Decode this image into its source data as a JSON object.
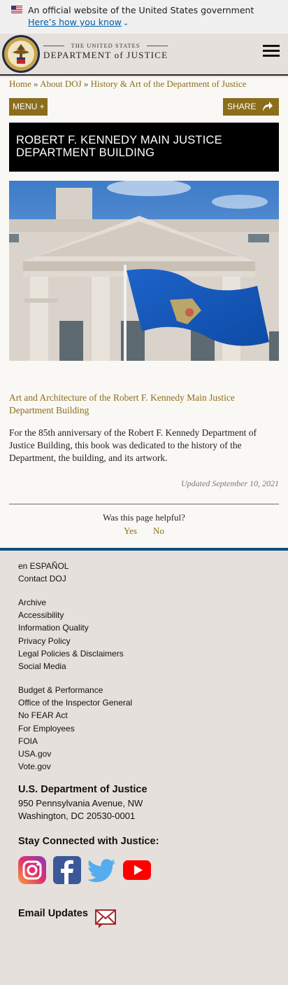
{
  "gov_banner": {
    "text": "An official website of the United States government",
    "link": "Here’s how you know"
  },
  "header": {
    "wordmark_top": "THE UNITED STATES",
    "wordmark_main": "DEPARTMENT of JUSTICE"
  },
  "breadcrumb": {
    "items": [
      "Home",
      "About DOJ",
      "History & Art of the Department of Justice"
    ],
    "separator": "»"
  },
  "buttons": {
    "menu": "MENU +",
    "share": "SHARE"
  },
  "page": {
    "title": "ROBERT F. KENNEDY MAIN JUSTICE DEPARTMENT BUILDING",
    "art_link": "Art and Architecture of the Robert F. Kennedy Main Justice Department Building",
    "body": "For the 85th anniversary of the Robert F. Kennedy Department of Justice Building, this book was dedicated to the history of the Department, the building, and its artwork.",
    "updated": "Updated September 10, 2021",
    "helpful_question": "Was this page helpful?",
    "helpful_yes": "Yes",
    "helpful_no": "No"
  },
  "footer": {
    "group1": [
      "en ESPAÑOL",
      "Contact DOJ"
    ],
    "group2": [
      "Archive",
      "Accessibility",
      "Information Quality",
      "Privacy Policy",
      "Legal Policies & Disclaimers",
      "Social Media"
    ],
    "group3": [
      "Budget & Performance",
      "Office of the Inspector General",
      "No FEAR Act",
      "For Employees",
      "FOIA",
      "USA.gov",
      "Vote.gov"
    ],
    "address_title": "U.S. Department of Justice",
    "address_line1": "950 Pennsylvania Avenue, NW",
    "address_line2": "Washington, DC 20530-0001",
    "stay_connected": "Stay Connected with Justice:",
    "social": [
      "instagram-icon",
      "facebook-icon",
      "twitter-icon",
      "youtube-icon"
    ],
    "email_updates": "Email Updates"
  },
  "colors": {
    "gold": "#8b6d1c",
    "footer_stripe": "#0b4f80",
    "header_bg": "#e5e0dc",
    "content_bg": "#f9f8f4"
  }
}
